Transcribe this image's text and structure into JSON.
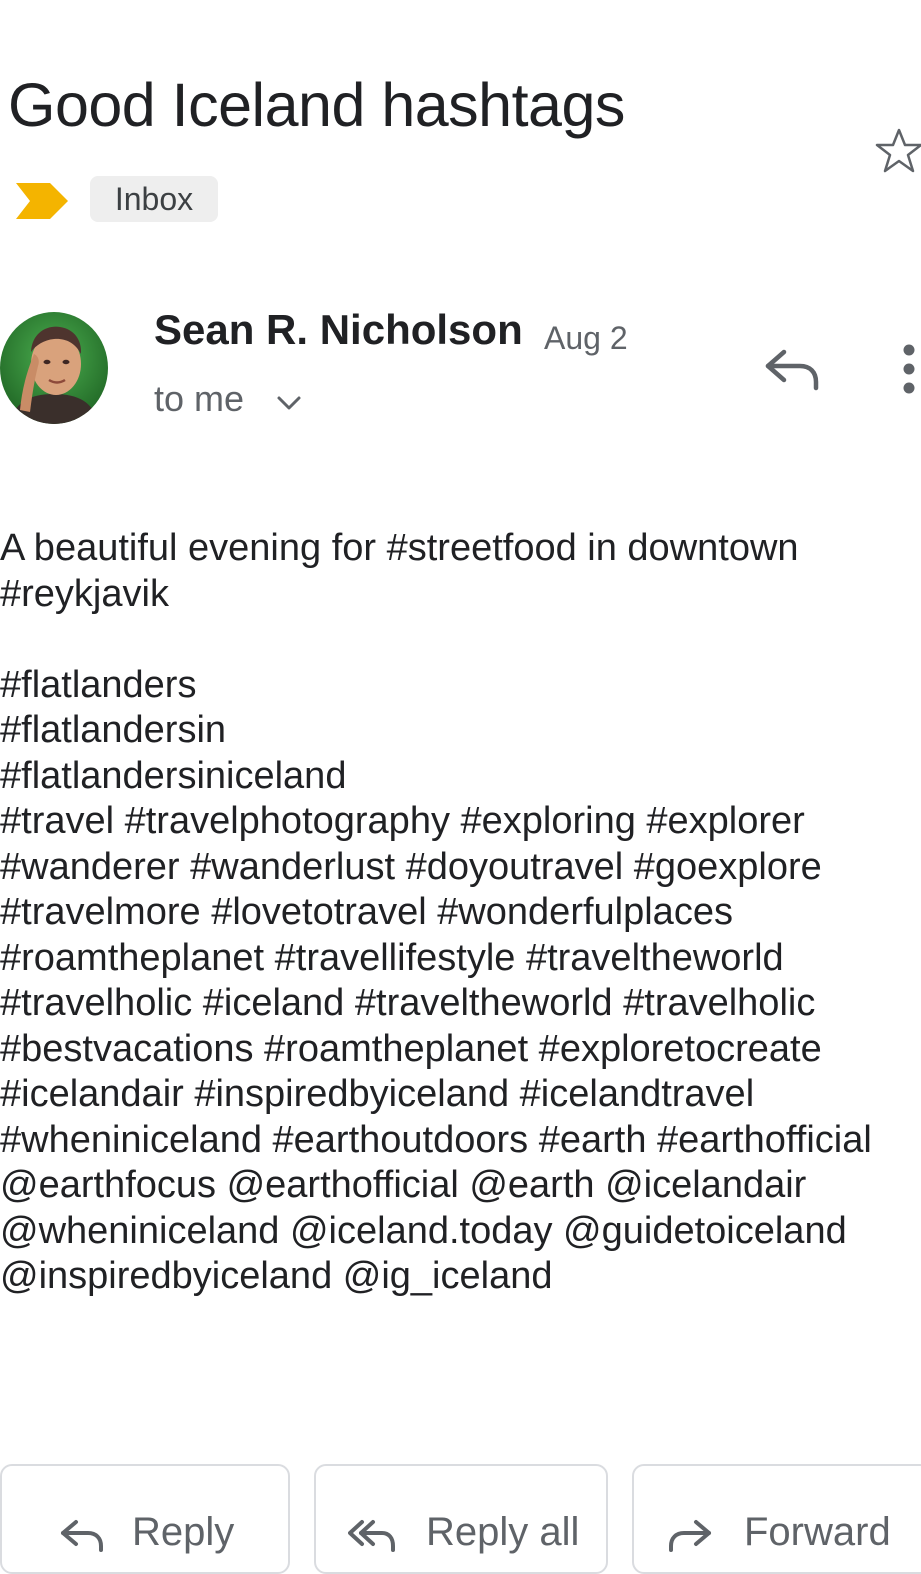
{
  "email": {
    "subject": "Good Iceland hashtags",
    "label": "Inbox",
    "sender_name": "Sean R. Nicholson",
    "date": "Aug 2",
    "recipient": "to me",
    "body_lines": [
      "A beautiful evening for #streetfood in downtown",
      "#reykjavik",
      "",
      "#flatlanders",
      "#flatlandersin",
      "#flatlandersiniceland",
      "#travel #travelphotography #exploring #explorer",
      "#wanderer #wanderlust #doyoutravel #goexplore",
      "#travelmore #lovetotravel #wonderfulplaces",
      "#roamtheplanet #travellifestyle #traveltheworld",
      "#travelholic #iceland #traveltheworld #travelholic",
      "#bestvacations #roamtheplanet #exploretocreate",
      "#icelandair #inspiredbyiceland #icelandtravel",
      "#wheniniceland #earthoutdoors #earth #earthofficial",
      "@earthfocus @earthofficial @earth @icelandair",
      "@wheniniceland @iceland.today @guidetoiceland",
      "@inspiredbyiceland @ig_iceland"
    ]
  },
  "actions": {
    "reply_label": "Reply",
    "reply_all_label": "Reply all",
    "forward_label": "Forward"
  },
  "icons": {
    "star": "star-outline-icon",
    "importance": "importance-marker-icon",
    "reply": "reply-icon",
    "reply_all": "reply-all-icon",
    "forward": "forward-icon",
    "more": "more-vert-icon",
    "chevron": "chevron-down-icon"
  },
  "colors": {
    "importance_marker": "#f4b400",
    "chip_background": "#eeeeee",
    "secondary_text": "#5f6368",
    "button_border": "#dadce0"
  }
}
